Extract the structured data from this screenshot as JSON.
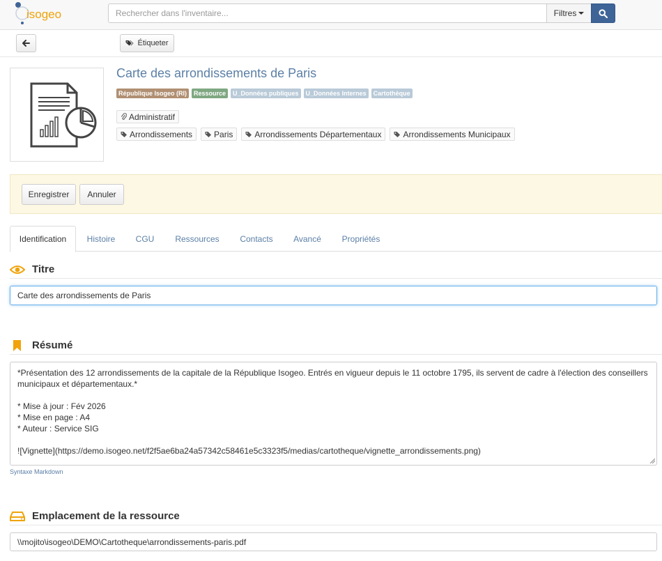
{
  "header": {
    "logo_text": "isogeo",
    "search": {
      "placeholder": "Rechercher dans l'inventaire...",
      "value": ""
    },
    "filters_label": "Filtres",
    "search_icon": "search-icon"
  },
  "toolbar": {
    "back_icon": "arrow-left-icon",
    "tag_label": "Étiqueter"
  },
  "record": {
    "title": "Carte des arrondissements de Paris",
    "badges": [
      {
        "label": "République Isogeo (RI)",
        "color": "#b08f72"
      },
      {
        "label": "Ressource",
        "color": "#7fa882"
      },
      {
        "label": "U_Données publiques",
        "color": "#b9cad8"
      },
      {
        "label": "U_Données Internes",
        "color": "#b9cad8"
      },
      {
        "label": "Cartothèque",
        "color": "#b9cad8"
      }
    ],
    "group_tag": "Administratif",
    "keywords": [
      "Arrondissements",
      "Paris",
      "Arrondissements Départementaux",
      "Arrondissements Municipaux"
    ]
  },
  "actions": {
    "save_label": "Enregistrer",
    "cancel_label": "Annuler"
  },
  "tabs": [
    {
      "label": "Identification",
      "active": true
    },
    {
      "label": "Histoire"
    },
    {
      "label": "CGU"
    },
    {
      "label": "Ressources"
    },
    {
      "label": "Contacts"
    },
    {
      "label": "Avancé"
    },
    {
      "label": "Propriétés"
    }
  ],
  "sections": {
    "title": {
      "heading": "Titre",
      "value": "Carte des arrondissements de Paris"
    },
    "summary": {
      "heading": "Résumé",
      "lines": [
        "*Présentation des 12 arrondissements de la capitale de la République Isogeo. Entrés en vigueur depuis le 11 octobre 1795, ils servent de cadre à l'élection des conseillers municipaux et départementaux.*",
        "",
        "* Mise à jour : Fév 2026",
        "* Mise en page : A4",
        "* Auteur : Service SIG",
        "",
        "![Vignette](https://demo.isogeo.net/f2f5ae6ba24a57342c58461e5c3323f5/medias/cartotheque/vignette_arrondissements.png)"
      ],
      "markdown_link": "Syntaxe Markdown"
    },
    "location": {
      "heading": "Emplacement de la ressource",
      "value": "\\\\mojito\\isogeo\\DEMO\\Cartotheque\\arrondissements-paris.pdf"
    }
  },
  "colors": {
    "accent": "#f0a30a",
    "link": "#5b7fa6",
    "search_button": "#3f6497",
    "panel": "#fcf8e3"
  }
}
